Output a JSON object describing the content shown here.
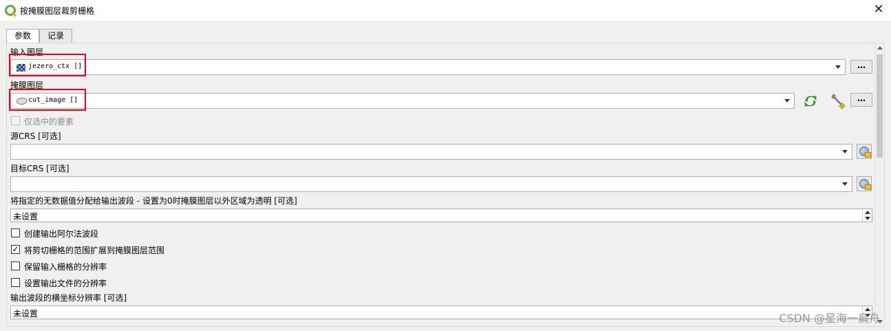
{
  "window": {
    "title": "按掩膜图层裁剪栅格",
    "close_label": "✕"
  },
  "tabs": [
    {
      "label": "参数"
    },
    {
      "label": "记录"
    }
  ],
  "fields": {
    "input_layer": {
      "label": "输入图层",
      "value": "jezero_ctx []",
      "button": "…"
    },
    "mask_layer": {
      "label": "掩膜图层",
      "value": "cut_image []",
      "button": "…"
    },
    "selected_only": {
      "label": "仅选中的要素",
      "checked": false,
      "enabled": false
    },
    "source_crs": {
      "label": "源CRS [可选]",
      "value": ""
    },
    "target_crs": {
      "label": "目标CRS [可选]",
      "value": ""
    },
    "nodata": {
      "label": "将指定的无数据值分配给输出波段 - 设置为0时掩膜图层以外区域为透明 [可选]",
      "value": "未设置"
    },
    "create_alpha": {
      "label": "创建输出阿尔法波段",
      "checked": false
    },
    "crop_to_cutline": {
      "label": "将剪切栅格的范围扩展到掩膜图层范围",
      "checked": true
    },
    "keep_resolution": {
      "label": "保留输入栅格的分辨率",
      "checked": false
    },
    "set_resolution": {
      "label": "设置输出文件的分辨率",
      "checked": false
    },
    "x_resolution": {
      "label": "输出波段的横坐标分辨率 [可选]",
      "value": "未设置"
    }
  },
  "watermark": "CSDN @星海一扁舟",
  "icons": {
    "app": "qgis-logo-icon",
    "raster": "raster-layer-icon",
    "polygon": "polygon-layer-icon",
    "sync": "sync-icon",
    "wrench": "wrench-icon",
    "crs": "crs-globe-icon"
  },
  "colors": {
    "highlight": "#e8001c",
    "sync": "#4caf2f"
  }
}
